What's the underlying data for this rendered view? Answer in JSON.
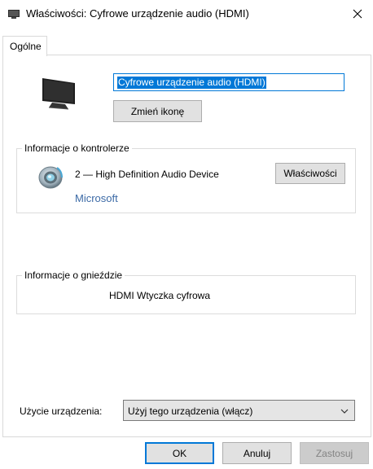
{
  "window": {
    "title": "Właściwości: Cyfrowe urządzenie audio (HDMI)",
    "title_icon": "speaker-window-icon",
    "close_icon": "close-icon"
  },
  "tabs": [
    {
      "label": "Ogólne",
      "active": true
    }
  ],
  "general": {
    "device_icon": "monitor-icon",
    "device_name_value": "Cyfrowe urządzenie audio (HDMI)",
    "change_icon_label": "Zmień ikonę",
    "controller_group": {
      "legend": "Informacje o kontrolerze",
      "icon": "speaker-icon",
      "device": "2 — High Definition Audio Device",
      "vendor": "Microsoft",
      "properties_label": "Właściwości"
    },
    "jack_group": {
      "legend": "Informacje o gnieździe",
      "value": "HDMI Wtyczka cyfrowa"
    },
    "usage": {
      "label": "Użycie urządzenia:",
      "selected": "Użyj tego urządzenia (włącz)"
    }
  },
  "footer": {
    "ok_label": "OK",
    "cancel_label": "Anuluj",
    "apply_label": "Zastosuj",
    "apply_disabled": true
  },
  "colors": {
    "accent": "#0078d7",
    "vendor_link": "#3c6aa6",
    "button_face": "#e1e1e1",
    "disabled_text": "#838383"
  }
}
